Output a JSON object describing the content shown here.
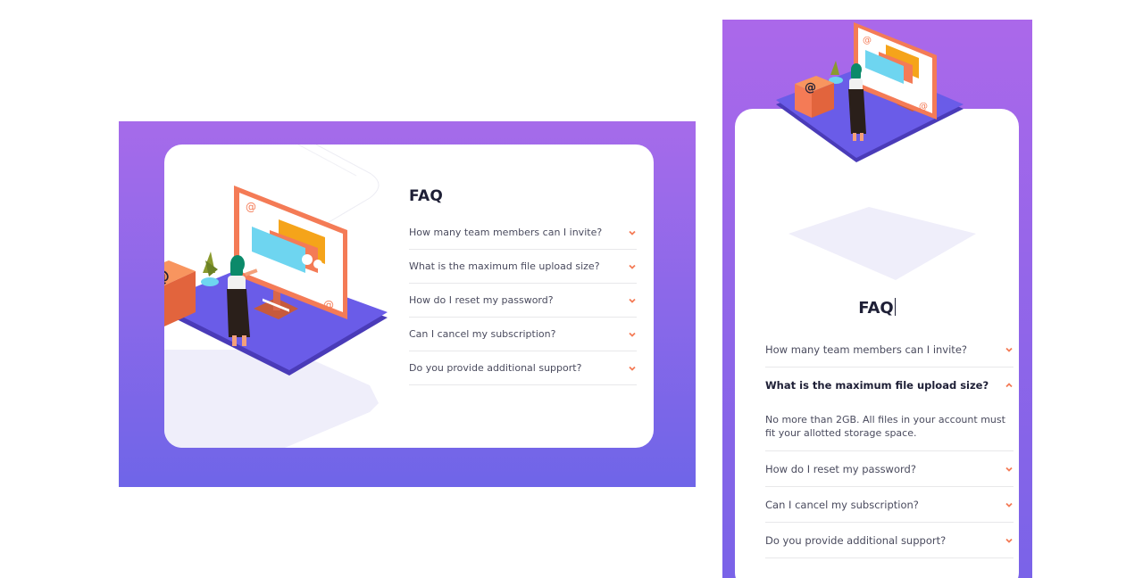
{
  "colors": {
    "gradient_top": "#a66bea",
    "gradient_bottom": "#6f65e8",
    "accent": "#f47b56",
    "text_dark": "#1e1f36",
    "text_muted": "#4a4b5e",
    "divider": "#e8e8ea"
  },
  "desktop": {
    "title": "FAQ",
    "questions": [
      {
        "label": "How many team members can I invite?",
        "expanded": false
      },
      {
        "label": "What is the maximum file upload size?",
        "expanded": false
      },
      {
        "label": "How do I reset my password?",
        "expanded": false
      },
      {
        "label": "Can I cancel my subscription?",
        "expanded": false
      },
      {
        "label": "Do you provide additional support?",
        "expanded": false
      }
    ]
  },
  "mobile": {
    "title": "FAQ",
    "questions": [
      {
        "label": "How many team members can I invite?",
        "expanded": false
      },
      {
        "label": "What is the maximum file upload size?",
        "expanded": true,
        "answer": "No more than 2GB. All files in your account must fit your allotted storage space."
      },
      {
        "label": "How do I reset my password?",
        "expanded": false
      },
      {
        "label": "Can I cancel my subscription?",
        "expanded": false
      },
      {
        "label": "Do you provide additional support?",
        "expanded": false
      }
    ]
  },
  "icons": {
    "chevron_down": "chevron-down-icon",
    "chevron_up": "chevron-up-icon",
    "box": "at-sign-box-icon"
  }
}
